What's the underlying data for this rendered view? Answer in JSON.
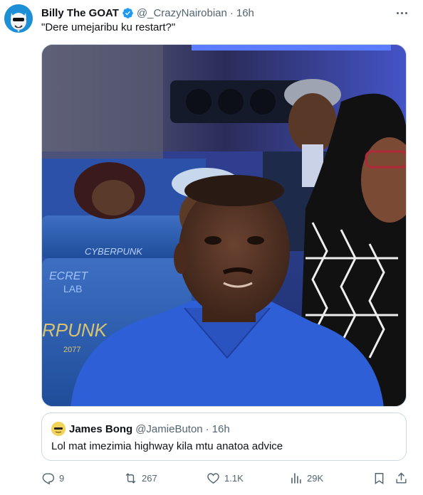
{
  "author": {
    "name": "Billy The GOAT",
    "handle": "@_CrazyNairobian",
    "time": "16h",
    "dot": "·"
  },
  "tweet": {
    "text": "\"Dere umejaribu ku restart?\""
  },
  "media": {
    "alt": "Photo of a man in a blue shirt sitting inside a decorated matatu with other passengers"
  },
  "quote": {
    "name": "James Bong",
    "handle": "@JamieButon",
    "time": "16h",
    "dot": "·",
    "text": "Lol mat imezimia highway kila mtu anatoa advice"
  },
  "actions": {
    "replies": "9",
    "retweets": "267",
    "likes": "1.1K",
    "views": "29K"
  },
  "colors": {
    "verified": "#1d9bf0",
    "secondary_text": "#536471",
    "border": "#cfd9de"
  },
  "icons": {
    "verified": "verified-badge-icon",
    "more": "more-icon",
    "reply": "reply-icon",
    "retweet": "retweet-icon",
    "like": "like-icon",
    "views": "views-icon",
    "bookmark": "bookmark-icon",
    "share": "share-icon"
  }
}
